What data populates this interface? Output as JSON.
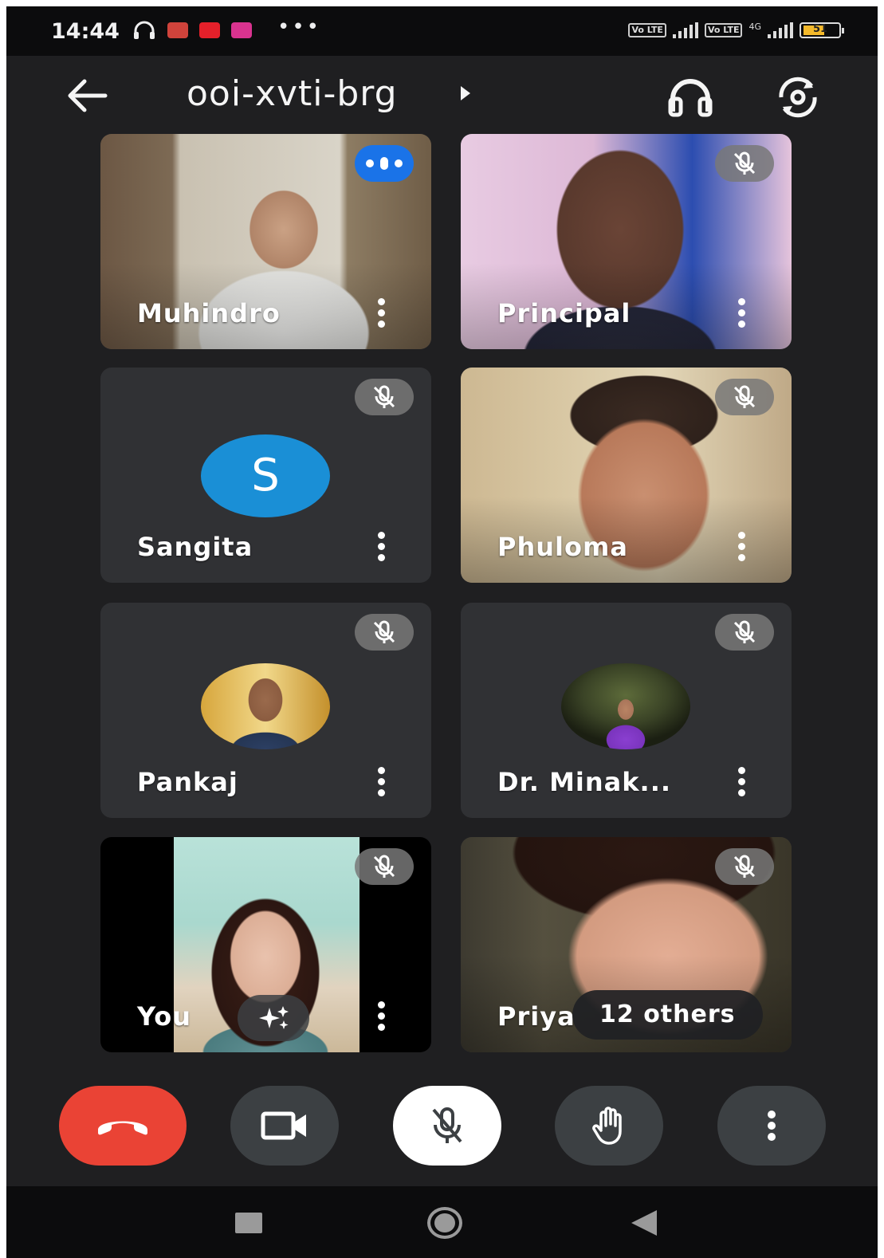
{
  "status_bar": {
    "time": "14:44",
    "network_label_1": "Vo LTE",
    "network_label_2": "Vo LTE",
    "network_type": "4G",
    "battery": "51"
  },
  "header": {
    "meeting_code": "ooi-xvti-brg"
  },
  "participants": [
    {
      "name": "Muhindro",
      "state": "speaking",
      "kind": "video"
    },
    {
      "name": "Principal",
      "state": "muted",
      "kind": "video"
    },
    {
      "name": "Sangita",
      "state": "muted",
      "kind": "letter-avatar",
      "initial": "S",
      "avatar_color": "#1a8fd6"
    },
    {
      "name": "Phuloma",
      "state": "muted",
      "kind": "video"
    },
    {
      "name": "Pankaj",
      "state": "muted",
      "kind": "photo-avatar"
    },
    {
      "name": "Dr. Minak...",
      "state": "muted",
      "kind": "photo-avatar"
    },
    {
      "name": "You",
      "state": "muted",
      "kind": "self-video"
    },
    {
      "name": "Priya",
      "state": "muted",
      "kind": "video"
    }
  ],
  "overflow": {
    "label": "12 others"
  },
  "controls": {
    "end_call_color": "#ea4335",
    "mic_state": "muted",
    "icons": [
      "end-call-icon",
      "camera-icon",
      "mic-off-icon",
      "raise-hand-icon",
      "more-vert-icon"
    ]
  },
  "colors": {
    "background": "#1f1f21",
    "tile": "#303134",
    "speaking_accent": "#1a73e8"
  }
}
